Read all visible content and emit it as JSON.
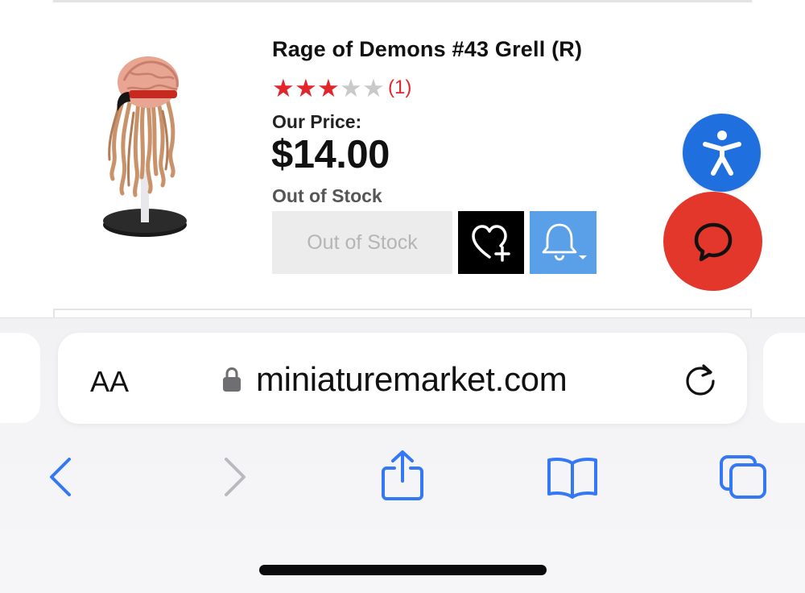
{
  "product": {
    "title": "Rage of Demons #43 Grell (R)",
    "rating_stars": 3,
    "rating_max": 5,
    "review_count": "(1)",
    "price_label": "Our Price:",
    "price": "$14.00",
    "stock_status": "Out of Stock",
    "button_label": "Out of Stock"
  },
  "browser": {
    "aa_label": "AA",
    "url": "miniaturemarket.com"
  },
  "colors": {
    "star_on": "#e3262c",
    "star_off": "#c9c9c9",
    "notify_button": "#5aa0e8",
    "accessibility_button": "#1f6fde",
    "chat_button": "#e4372b",
    "ios_blue": "#3478f6"
  },
  "icons": [
    "heart-plus-icon",
    "bell-icon",
    "accessibility-icon",
    "chat-icon",
    "lock-icon",
    "reload-icon",
    "back-icon",
    "forward-icon",
    "share-icon",
    "bookmarks-icon",
    "tabs-icon"
  ]
}
